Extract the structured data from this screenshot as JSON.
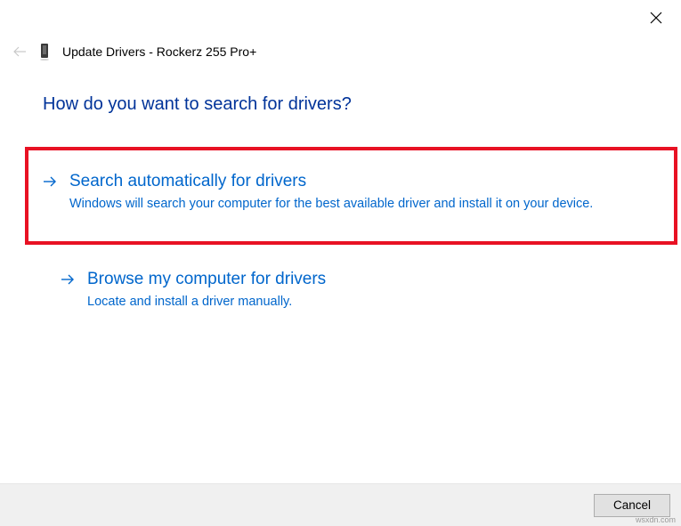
{
  "window": {
    "title": "Update Drivers - Rockerz 255 Pro+"
  },
  "heading": "How do you want to search for drivers?",
  "options": [
    {
      "title": "Search automatically for drivers",
      "desc": "Windows will search your computer for the best available driver and install it on your device."
    },
    {
      "title": "Browse my computer for drivers",
      "desc": "Locate and install a driver manually."
    }
  ],
  "buttons": {
    "cancel": "Cancel"
  },
  "watermark": "wsxdn.com"
}
